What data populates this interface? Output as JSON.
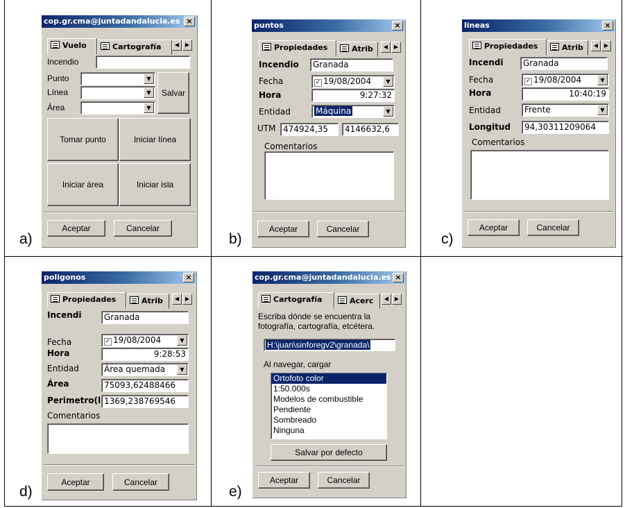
{
  "captions": {
    "a": "a)",
    "b": "b)",
    "c": "c)",
    "d": "d)",
    "e": "e)"
  },
  "panel_a": {
    "title": "cop.gr.cma@juntadandalucia.es",
    "tabs": [
      "Vuelo",
      "Cartografía"
    ],
    "incendio_label": "Incendio",
    "punto_label": "Punto",
    "linea_label": "Línea",
    "area_label": "Área",
    "salvar_button": "Salvar",
    "tomar_punto_button": "Tomar punto",
    "iniciar_linea_button": "Iniciar línea",
    "iniciar_area_button": "Iniciar área",
    "iniciar_isla_button": "Iniciar isla",
    "aceptar_button": "Aceptar",
    "cancelar_button": "Cancelar"
  },
  "panel_b": {
    "title": "puntos",
    "tabs": [
      "Propiedades",
      "Atrib"
    ],
    "incendio_label": "Incendio",
    "incendio_value": "Granada",
    "fecha_label": "Fecha",
    "fecha_value": "19/08/2004",
    "hora_label": "Hora",
    "hora_value": "9:27:32",
    "entidad_label": "Entidad",
    "entidad_value": "Máquina",
    "utm_label": "UTM",
    "utm_x": "474924,35",
    "utm_y": "4146632,6",
    "comentarios_label": "Comentarios",
    "aceptar_button": "Aceptar",
    "cancelar_button": "Cancelar"
  },
  "panel_c": {
    "title": "lineas",
    "tabs": [
      "Propiedades",
      "Atrib"
    ],
    "incendio_label": "Incendi",
    "incendio_value": "Granada",
    "fecha_label": "Fecha",
    "fecha_value": "19/08/2004",
    "hora_label": "Hora",
    "hora_value": "10:40:19",
    "entidad_label": "Entidad",
    "entidad_value": "Frente",
    "longitud_label": "Longitud",
    "longitud_value": "94,30311209064",
    "comentarios_label": "Comentarios",
    "aceptar_button": "Aceptar",
    "cancelar_button": "Cancelar"
  },
  "panel_d": {
    "title": "poligonos",
    "tabs": [
      "Propiedades",
      "Atrib"
    ],
    "incendio_label": "Incendi",
    "incendio_value": "Granada",
    "fecha_label": "Fecha",
    "fecha_value": "19/08/2004",
    "hora_label": "Hora",
    "hora_value": "9:28:53",
    "entidad_label": "Entidad",
    "entidad_value": "Área quemada",
    "area_label": "Área",
    "area_value": "75093,62488466",
    "perimetro_label": "Perimetro(l",
    "perimetro_value": "1369,238769546",
    "comentarios_label": "Comentarios",
    "aceptar_button": "Aceptar",
    "cancelar_button": "Cancelar"
  },
  "panel_e": {
    "title": "cop.gr.cma@juntadandalucia.es",
    "tabs": [
      "Cartografía",
      "Acerc"
    ],
    "description": "Escriba dónde se encuentra la fotografía, cartografía, etcétera.",
    "path_value": "H:\\juan\\sinforegv2\\granada\\",
    "load_label": "Al navegar, cargar",
    "list_items": [
      "Ortofoto color",
      "1:50.000s",
      "Modelos de combustible",
      "Pendiente",
      "Sombreado",
      "Ninguna"
    ],
    "salvar_defecto_button": "Salvar por defecto",
    "aceptar_button": "Aceptar",
    "cancelar_button": "Cancelar"
  }
}
